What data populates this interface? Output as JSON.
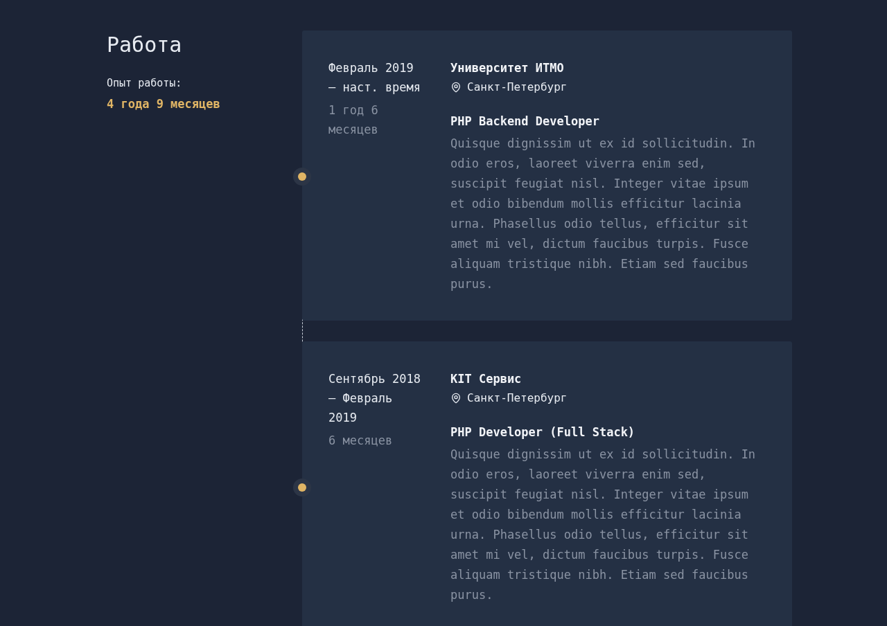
{
  "section": {
    "title": "Работа",
    "experience_label": "Опыт работы:",
    "experience_total": "4 года 9 месяцев"
  },
  "jobs": [
    {
      "period": "Февраль 2019 — наст. время",
      "duration": "1 год 6 месяцев",
      "company": "Университет ИТМО",
      "location": "Санкт-Петербург",
      "position": "PHP Backend Developer",
      "description": "Quisque dignissim ut ex id sollicitudin. In odio eros, laoreet viverra enim sed, suscipit feugiat nisl. Integer vitae ipsum et odio bibendum mollis efficitur lacinia urna. Phasellus odio tellus, efficitur sit amet mi vel, dictum faucibus turpis. Fusce aliquam tristique nibh. Etiam sed faucibus purus."
    },
    {
      "period": "Сентябрь 2018 — Февраль 2019",
      "duration": "6 месяцев",
      "company": "KIT Сервис",
      "location": "Санкт-Петербург",
      "position": "PHP Developer (Full Stack)",
      "description": "Quisque dignissim ut ex id sollicitudin. In odio eros, laoreet viverra enim sed, suscipit feugiat nisl. Integer vitae ipsum et odio bibendum mollis efficitur lacinia urna. Phasellus odio tellus, efficitur sit amet mi vel, dictum faucibus turpis. Fusce aliquam tristique nibh. Etiam sed faucibus purus."
    }
  ]
}
